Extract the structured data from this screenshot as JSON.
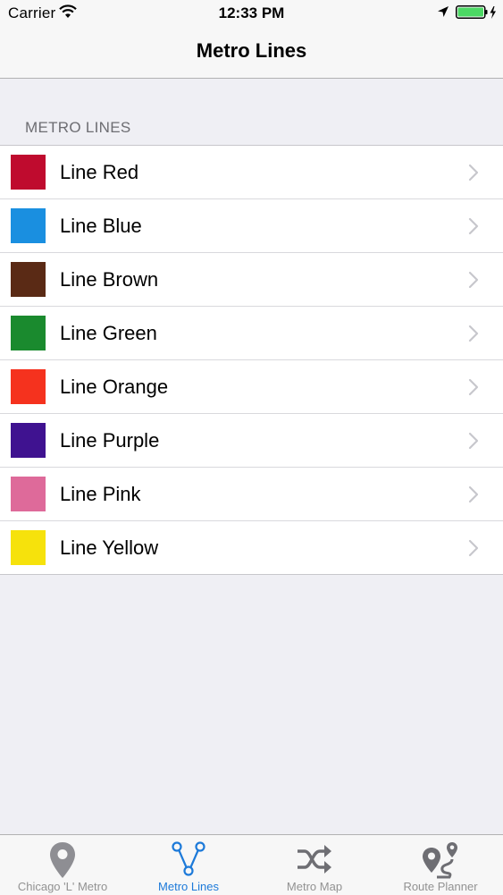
{
  "status_bar": {
    "carrier": "Carrier",
    "time": "12:33 PM"
  },
  "nav": {
    "title": "Metro Lines"
  },
  "section": {
    "header": "METRO LINES"
  },
  "lines": [
    {
      "label": "Line Red",
      "color": "#bf0b2e"
    },
    {
      "label": "Line Blue",
      "color": "#1a8fe0"
    },
    {
      "label": "Line Brown",
      "color": "#5a2a15"
    },
    {
      "label": "Line Green",
      "color": "#1a8a2e"
    },
    {
      "label": "Line Orange",
      "color": "#f5321e"
    },
    {
      "label": "Line Purple",
      "color": "#3f1290"
    },
    {
      "label": "Line Pink",
      "color": "#de6a9a"
    },
    {
      "label": "Line Yellow",
      "color": "#f6e20c"
    }
  ],
  "tabs": [
    {
      "label": "Chicago 'L' Metro",
      "icon": "map-pin-icon",
      "active": false
    },
    {
      "label": "Metro Lines",
      "icon": "route-nodes-icon",
      "active": true
    },
    {
      "label": "Metro Map",
      "icon": "shuffle-icon",
      "active": false
    },
    {
      "label": "Route Planner",
      "icon": "route-planner-icon",
      "active": false
    }
  ],
  "colors": {
    "accent": "#1d7ad9",
    "inactive_tab": "#8e8e93",
    "background": "#efeff4"
  }
}
